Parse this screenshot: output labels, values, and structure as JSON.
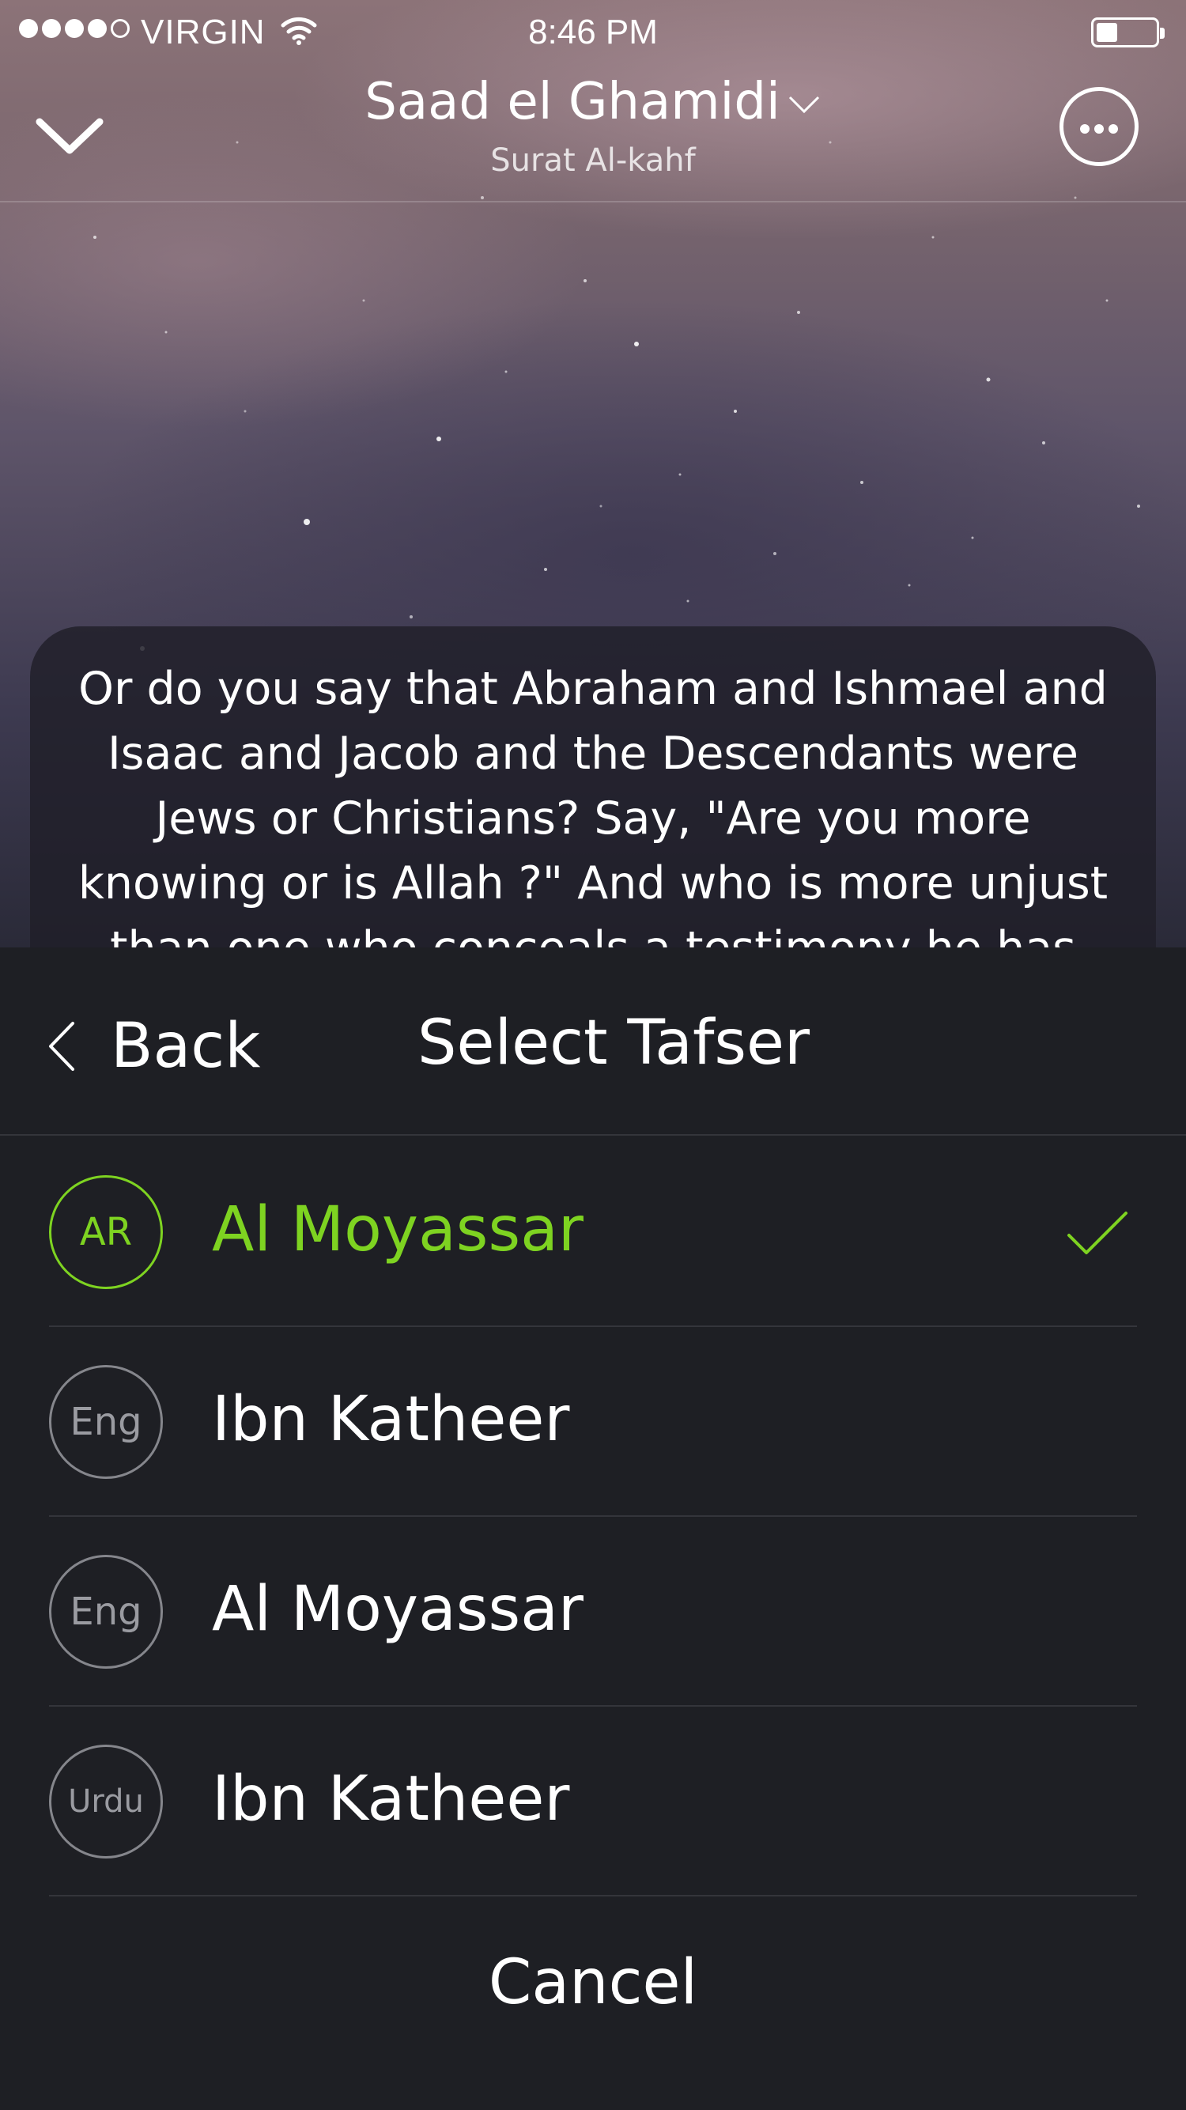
{
  "status_bar": {
    "carrier": "VIRGIN",
    "time": "8:46 PM"
  },
  "header": {
    "title": "Saad el Ghamidi",
    "subtitle": "Surat Al-kahf"
  },
  "verse": {
    "text": "Or do you say that Abraham and Ishmael and Isaac and Jacob and the Descendants were Jews or Christians? Say, \"Are you more knowing or is Allah ?\" And who is more unjust than one who conceals a testimony he has from Allah ?"
  },
  "sheet": {
    "back_label": "Back",
    "title": "Select Tafser",
    "options": [
      {
        "lang": "AR",
        "label": "Al Moyassar",
        "selected": true
      },
      {
        "lang": "Eng",
        "label": "Ibn Katheer",
        "selected": false
      },
      {
        "lang": "Eng",
        "label": "Al Moyassar",
        "selected": false
      },
      {
        "lang": "Urdu",
        "label": "Ibn Katheer",
        "selected": false
      }
    ],
    "cancel_label": "Cancel"
  },
  "colors": {
    "accent": "#7ed321",
    "sheet_bg": "#1e1f24",
    "divider": "#34353b"
  },
  "icons": {
    "collapse": "chevron-down-icon",
    "title_caret": "caret-down-icon",
    "more": "more-icon",
    "back": "chevron-left-icon",
    "selected": "checkmark-icon"
  }
}
